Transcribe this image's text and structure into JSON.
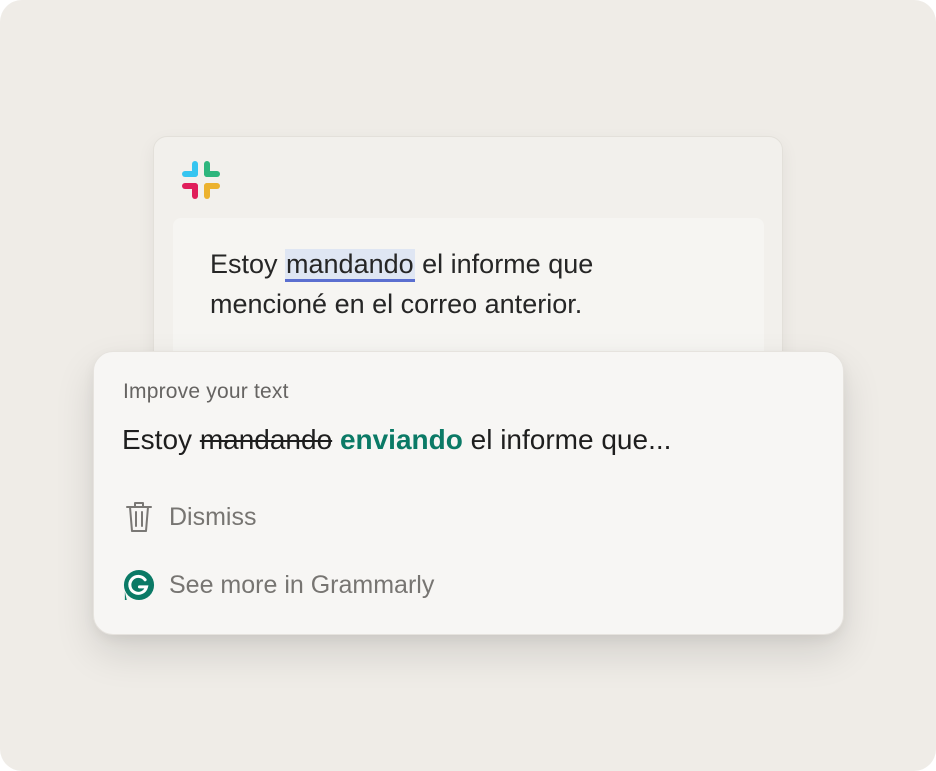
{
  "message": {
    "app_icon": "slack-logo-icon",
    "before": "Estoy ",
    "highlighted": "mandando",
    "after_line1": " el informe que",
    "line2": "mencioné en el correo anterior."
  },
  "suggestion": {
    "title": "Improve your text",
    "prefix": "Estoy ",
    "removed": "mandando",
    "added": "enviando",
    "suffix": " el informe que...",
    "accent_color": "#0b7a66"
  },
  "actions": {
    "dismiss_label": "Dismiss",
    "dismiss_icon": "trash-icon",
    "grammarly_label": "See more in Grammarly",
    "grammarly_icon": "grammarly-logo-icon"
  },
  "colors": {
    "background": "#efece7",
    "highlight": "#dfe6f3",
    "underline": "#5b6fd0"
  }
}
